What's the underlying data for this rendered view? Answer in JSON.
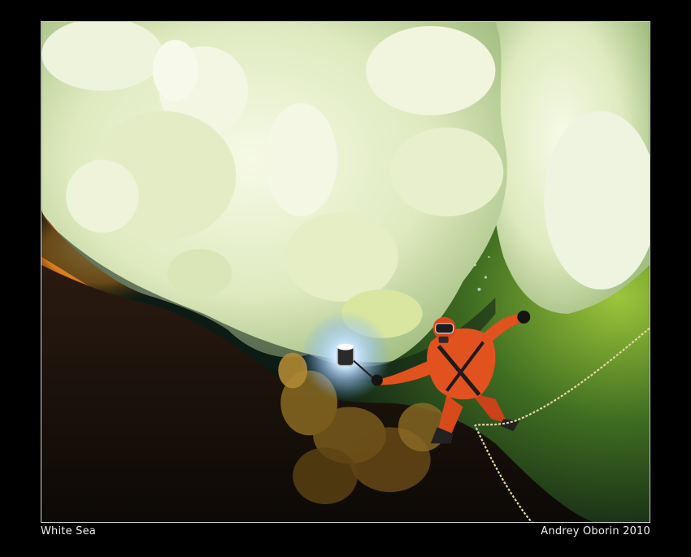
{
  "captions": {
    "location": "White Sea",
    "credit": "Andrey Oborin 2010"
  },
  "colors": {
    "frame": "#000000",
    "ice": "#e9f2d2",
    "ice_shadow": "#a9c48a",
    "glow_orange": "#f2a33a",
    "water_green": "#7da52a",
    "water_dark": "#0c1a14",
    "suit_orange": "#e2521f",
    "rope": "#e6d6a4"
  }
}
